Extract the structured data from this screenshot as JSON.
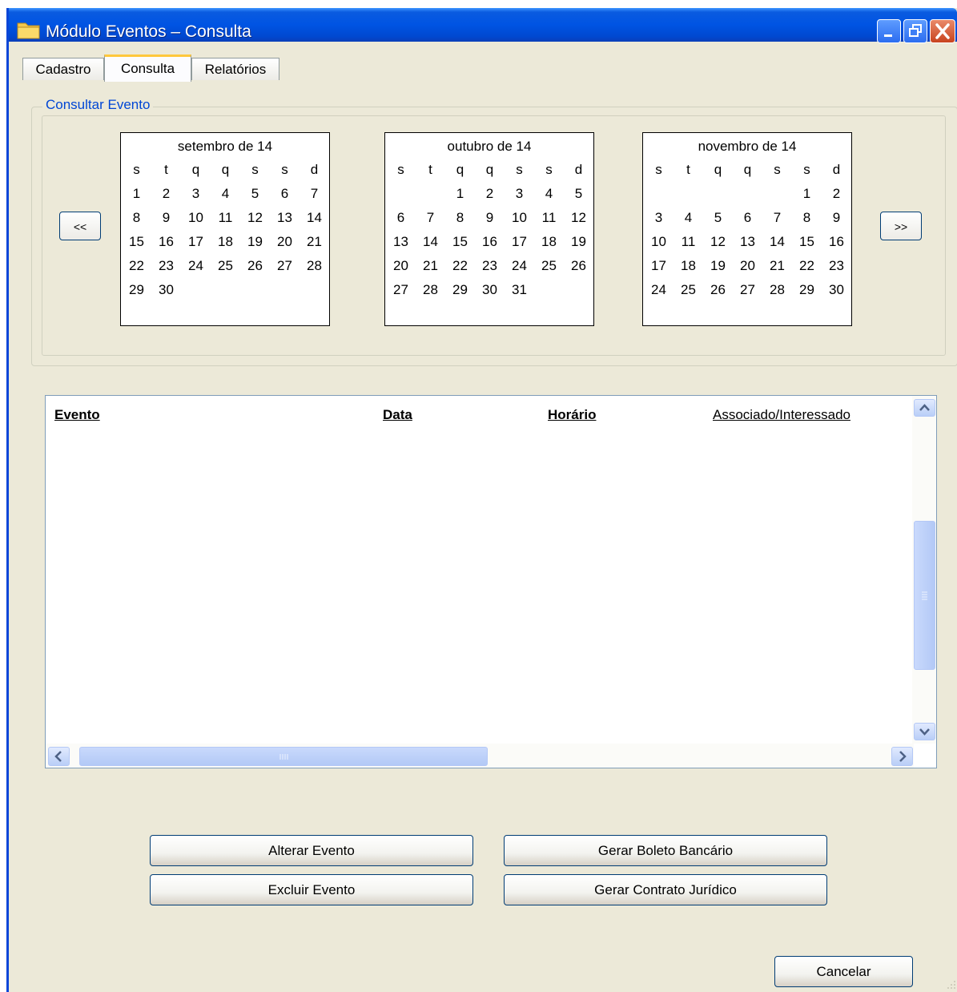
{
  "window": {
    "title": "Módulo Eventos – Consulta"
  },
  "tabs": [
    {
      "label": "Cadastro"
    },
    {
      "label": "Consulta"
    },
    {
      "label": "Relatórios"
    }
  ],
  "panel": {
    "legend": "Consultar Evento",
    "prev_label": "<<",
    "next_label": ">>"
  },
  "weekdays": [
    "s",
    "t",
    "q",
    "q",
    "s",
    "s",
    "d"
  ],
  "calendars": [
    {
      "month": "setembro de 14",
      "weeks": [
        [
          "1",
          "2",
          "3",
          "4",
          "5",
          "6",
          "7"
        ],
        [
          "8",
          "9",
          "10",
          "11",
          "12",
          "13",
          "14"
        ],
        [
          "15",
          "16",
          "17",
          "18",
          "19",
          "20",
          "21"
        ],
        [
          "22",
          "23",
          "24",
          "25",
          "26",
          "27",
          "28"
        ],
        [
          "29",
          "30",
          "",
          "",
          "",
          "",
          ""
        ]
      ]
    },
    {
      "month": "outubro de 14",
      "weeks": [
        [
          "",
          "",
          "1",
          "2",
          "3",
          "4",
          "5"
        ],
        [
          "6",
          "7",
          "8",
          "9",
          "10",
          "11",
          "12"
        ],
        [
          "13",
          "14",
          "15",
          "16",
          "17",
          "18",
          "19"
        ],
        [
          "20",
          "21",
          "22",
          "23",
          "24",
          "25",
          "26"
        ],
        [
          "27",
          "28",
          "29",
          "30",
          "31",
          "",
          ""
        ]
      ]
    },
    {
      "month": "novembro de 14",
      "weeks": [
        [
          "",
          "",
          "",
          "",
          "",
          "1",
          "2"
        ],
        [
          "3",
          "4",
          "5",
          "6",
          "7",
          "8",
          "9"
        ],
        [
          "10",
          "11",
          "12",
          "13",
          "14",
          "15",
          "16"
        ],
        [
          "17",
          "18",
          "19",
          "20",
          "21",
          "22",
          "23"
        ],
        [
          "24",
          "25",
          "26",
          "27",
          "28",
          "29",
          "30"
        ]
      ]
    }
  ],
  "table": {
    "columns": [
      "Evento",
      "Data",
      "Horário",
      "Associado/Interessado"
    ]
  },
  "buttons": {
    "alterar": "Alterar Evento",
    "excluir": "Excluir Evento",
    "boleto": "Gerar Boleto Bancário",
    "contrato": "Gerar Contrato Jurídico",
    "cancelar": "Cancelar"
  }
}
